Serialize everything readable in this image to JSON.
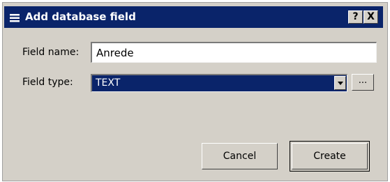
{
  "dialog": {
    "title": "Add database field",
    "title_icon": "database-stack-icon",
    "help_label": "?",
    "close_label": "X"
  },
  "form": {
    "field_name_label": "Field name:",
    "field_name_value": "Anrede",
    "field_type_label": "Field type:",
    "field_type_value": "TEXT",
    "more_label": "..."
  },
  "buttons": {
    "cancel_label": "Cancel",
    "create_label": "Create"
  },
  "colors": {
    "titlebar": "#0a246a",
    "face": "#d4d0c8",
    "selection": "#0a246a"
  }
}
